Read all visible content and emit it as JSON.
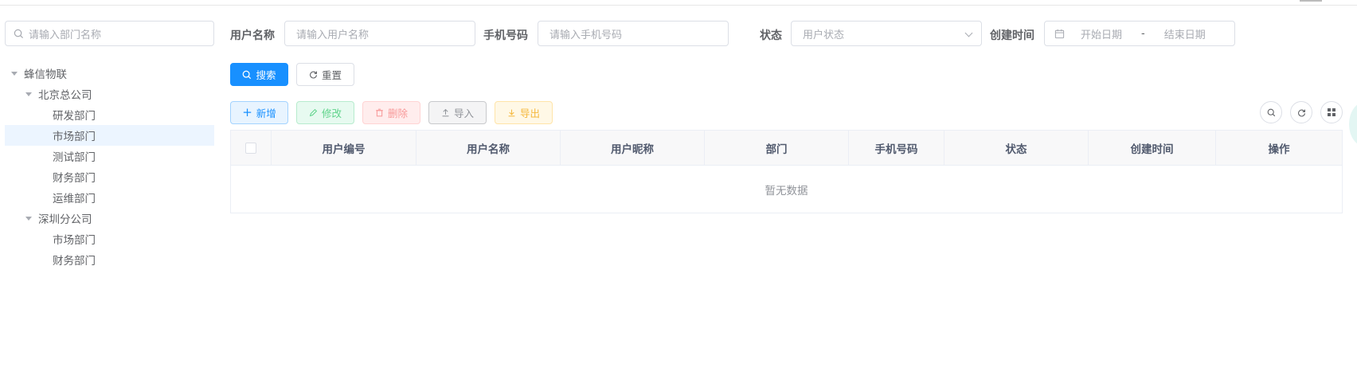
{
  "dept_search": {
    "placeholder": "请输入部门名称"
  },
  "tree": {
    "root": "蜂信物联",
    "beijing": "北京总公司",
    "beijing_children": [
      "研发部门",
      "市场部门",
      "测试部门",
      "财务部门",
      "运维部门"
    ],
    "shenzhen": "深圳分公司",
    "shenzhen_children": [
      "市场部门",
      "财务部门"
    ]
  },
  "form": {
    "username_label": "用户名称",
    "username_placeholder": "请输入用户名称",
    "phone_label": "手机号码",
    "phone_placeholder": "请输入手机号码",
    "status_label": "状态",
    "status_placeholder": "用户状态",
    "created_label": "创建时间",
    "start_placeholder": "开始日期",
    "range_sep": "-",
    "end_placeholder": "结束日期"
  },
  "buttons": {
    "search": "搜索",
    "reset": "重置",
    "add": "新增",
    "edit": "修改",
    "delete": "删除",
    "import": "导入",
    "export": "导出"
  },
  "table": {
    "columns": [
      "用户编号",
      "用户名称",
      "用户昵称",
      "部门",
      "手机号码",
      "状态",
      "创建时间",
      "操作"
    ],
    "empty_text": "暂无数据"
  },
  "colors": {
    "primary": "#1890ff",
    "selected_bg": "#ecf5ff"
  }
}
